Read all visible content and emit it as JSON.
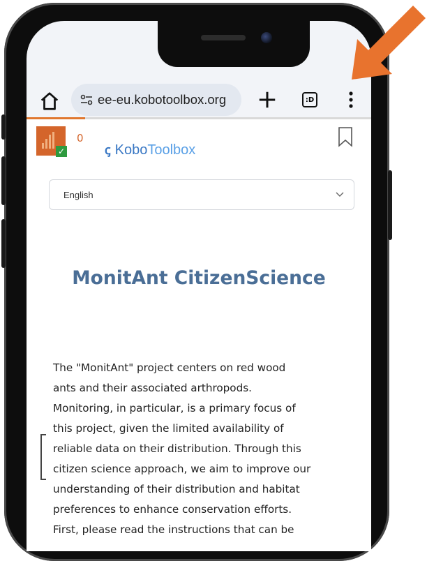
{
  "browser": {
    "url": "ee-eu.kobotoolbox.org",
    "tabs_count": ":D",
    "progress_percent": 100
  },
  "header": {
    "badge_count": "0",
    "logo_text_kobo": "Kobo",
    "logo_text_toolbox": "Toolbox"
  },
  "language_select": {
    "selected": "English"
  },
  "form": {
    "title": "MonitAnt CitizenScience",
    "intro_lines": [
      "The \"MonitAnt\" project centers on red wood",
      "ants and their associated arthropods.",
      "Monitoring, in particular, is a primary focus of",
      "this project, given the limited availability of",
      "reliable data on their distribution. Through this",
      "citizen science approach, we aim to improve our",
      "understanding of their distribution and habitat",
      "preferences to enhance conservation efforts.",
      "First, please read the instructions that can be"
    ]
  },
  "colors": {
    "arrow": "#e8732e",
    "title": "#4a6e96",
    "logo": "#3a78c4",
    "badge": "#d4652b"
  },
  "icons": [
    "home-icon",
    "tune-icon",
    "plus-icon",
    "tabs-icon",
    "more-vert-icon",
    "bookmark-icon",
    "chevron-down-icon",
    "chart-badge-icon",
    "check-icon",
    "orange-arrow-icon"
  ]
}
